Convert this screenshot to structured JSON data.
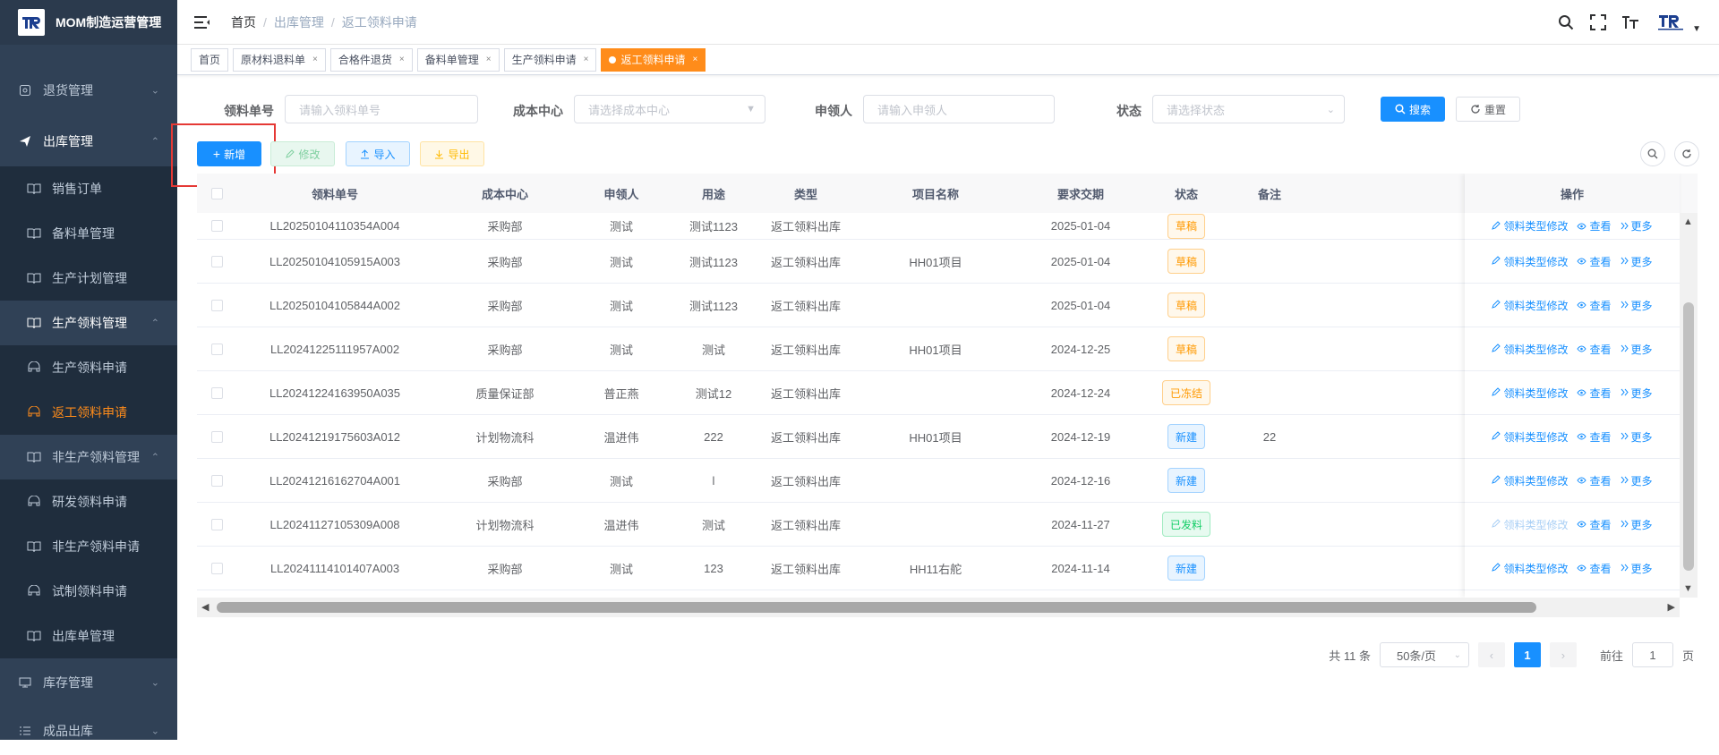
{
  "app": {
    "title": "MOM制造运营管理"
  },
  "sidebar": {
    "items": [
      {
        "label": "退货管理",
        "icon": "return-icon"
      },
      {
        "label": "出库管理",
        "icon": "send-icon"
      },
      {
        "label": "销售订单",
        "icon": "book-icon"
      },
      {
        "label": "备料单管理",
        "icon": "book-icon"
      },
      {
        "label": "生产计划管理",
        "icon": "book-icon"
      },
      {
        "label": "生产领料管理",
        "icon": "book-icon"
      },
      {
        "label": "生产领料申请",
        "icon": "cart-icon"
      },
      {
        "label": "返工领料申请",
        "icon": "cart-icon"
      },
      {
        "label": "非生产领料管理",
        "icon": "book-icon"
      },
      {
        "label": "研发领料申请",
        "icon": "cart-icon"
      },
      {
        "label": "非生产领料申请",
        "icon": "book-icon"
      },
      {
        "label": "试制领料申请",
        "icon": "cart-icon"
      },
      {
        "label": "出库单管理",
        "icon": "book-icon"
      },
      {
        "label": "库存管理",
        "icon": "monitor-icon"
      },
      {
        "label": "成品出库",
        "icon": "list-icon"
      }
    ]
  },
  "breadcrumb": [
    "首页",
    "出库管理",
    "返工领料申请"
  ],
  "tags": [
    "首页",
    "原材料退料单",
    "合格件退货",
    "备料单管理",
    "生产领料申请",
    "返工领料申请"
  ],
  "search": {
    "order_label": "领料单号",
    "order_placeholder": "请输入领料单号",
    "cost_label": "成本中心",
    "cost_placeholder": "请选择成本中心",
    "applicant_label": "申领人",
    "applicant_placeholder": "请输入申领人",
    "status_label": "状态",
    "status_placeholder": "请选择状态",
    "search_btn": "搜索",
    "reset_btn": "重置"
  },
  "toolbar": {
    "add": "新增",
    "edit": "修改",
    "import": "导入",
    "export": "导出"
  },
  "table": {
    "columns": [
      "领料单号",
      "成本中心",
      "申领人",
      "用途",
      "类型",
      "项目名称",
      "要求交期",
      "状态",
      "备注",
      "操作"
    ],
    "rows": [
      {
        "no": "LL20250104110354A004",
        "cost": "采购部",
        "applicant": "测试",
        "usage": "测试1123",
        "type": "返工领料出库",
        "project": "",
        "date": "2025-01-04",
        "status": "草稿",
        "st": "draft",
        "remark": ""
      },
      {
        "no": "LL20250104105915A003",
        "cost": "采购部",
        "applicant": "测试",
        "usage": "测试1123",
        "type": "返工领料出库",
        "project": "HH01项目",
        "date": "2025-01-04",
        "status": "草稿",
        "st": "draft",
        "remark": ""
      },
      {
        "no": "LL20250104105844A002",
        "cost": "采购部",
        "applicant": "测试",
        "usage": "测试1123",
        "type": "返工领料出库",
        "project": "",
        "date": "2025-01-04",
        "status": "草稿",
        "st": "draft",
        "remark": ""
      },
      {
        "no": "LL20241225111957A002",
        "cost": "采购部",
        "applicant": "测试",
        "usage": "测试",
        "type": "返工领料出库",
        "project": "HH01项目",
        "date": "2024-12-25",
        "status": "草稿",
        "st": "draft",
        "remark": ""
      },
      {
        "no": "LL20241224163950A035",
        "cost": "质量保证部",
        "applicant": "普正燕",
        "usage": "测试12",
        "type": "返工领料出库",
        "project": "",
        "date": "2024-12-24",
        "status": "已冻结",
        "st": "frozen",
        "remark": ""
      },
      {
        "no": "LL20241219175603A012",
        "cost": "计划物流科",
        "applicant": "温进伟",
        "usage": "222",
        "type": "返工领料出库",
        "project": "HH01项目",
        "date": "2024-12-19",
        "status": "新建",
        "st": "new",
        "remark": "22"
      },
      {
        "no": "LL20241216162704A001",
        "cost": "采购部",
        "applicant": "测试",
        "usage": "l",
        "type": "返工领料出库",
        "project": "",
        "date": "2024-12-16",
        "status": "新建",
        "st": "new",
        "remark": ""
      },
      {
        "no": "LL20241127105309A008",
        "cost": "计划物流科",
        "applicant": "温进伟",
        "usage": "测试",
        "type": "返工领料出库",
        "project": "",
        "date": "2024-11-27",
        "status": "已发料",
        "st": "issued",
        "remark": ""
      },
      {
        "no": "LL20241114101407A003",
        "cost": "采购部",
        "applicant": "测试",
        "usage": "123",
        "type": "返工领料出库",
        "project": "HH11右舵",
        "date": "2024-11-14",
        "status": "新建",
        "st": "new",
        "remark": ""
      }
    ],
    "ops": {
      "modify": "领料类型修改",
      "view": "查看",
      "more": "更多"
    }
  },
  "pagination": {
    "total": "共 11 条",
    "size": "50条/页",
    "page": "1",
    "goto_label": "前往",
    "goto_value": "1",
    "goto_suffix": "页"
  },
  "colors": {
    "primary": "#1890ff",
    "accent": "#ff8c1a",
    "sidebar": "#304156"
  }
}
